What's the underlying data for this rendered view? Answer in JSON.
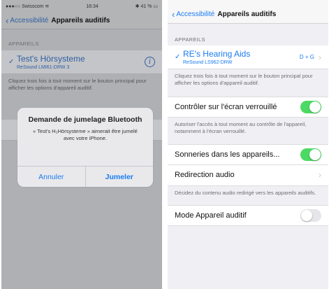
{
  "left": {
    "status": {
      "carrier": "●●●○○ Swisscom ≋",
      "time": "18:34",
      "battery": "✱ 41 % ▭"
    },
    "nav": {
      "back_label": "Accessibilité",
      "title": "Appareils auditifs"
    },
    "section_header": "APPAREILS",
    "device": {
      "name": "Test's Hörsysteme",
      "model": "ReSound LMI61-DRW 3"
    },
    "footer": "Cliquez trois fois à tout moment sur le bouton principal pour afficher les options d'appareil auditif.",
    "alert": {
      "title": "Demande de jumelage Bluetooth",
      "message": "« Test's H₂Hörsysteme » aimerait être jumelé avec votre iPhone.",
      "cancel_label": "Annuler",
      "pair_label": "Jumeler"
    }
  },
  "right": {
    "nav": {
      "back_label": "Accessibilité",
      "title": "Appareils auditifs"
    },
    "section_header": "APPAREILS",
    "device": {
      "name": "RE's Hearing Aids",
      "model": "ReSound LS962-DRW",
      "status": "D + G"
    },
    "footer_device": "Cliquez trois fois à tout moment sur le bouton principal pour afficher les options d'appareil auditif.",
    "lock_screen": {
      "label": "Contrôler sur l'écran verrouillé",
      "on": true
    },
    "footer_lock": "Autoriser l'accès à tout moment au contrôle de l'appareil, notamment à l'écran verrouillé.",
    "ringtones": {
      "label": "Sonneries dans les appareils...",
      "on": true
    },
    "audio_routing": {
      "label": "Redirection audio"
    },
    "footer_routing": "Décidez du contenu audio redirigé vers les appareils auditifs.",
    "hearing_mode": {
      "label": "Mode Appareil auditif",
      "on": false
    }
  },
  "colors": {
    "accent": "#1a7bf0",
    "toggle_on": "#4cd964",
    "toggle_off": "#e5e5ea"
  }
}
